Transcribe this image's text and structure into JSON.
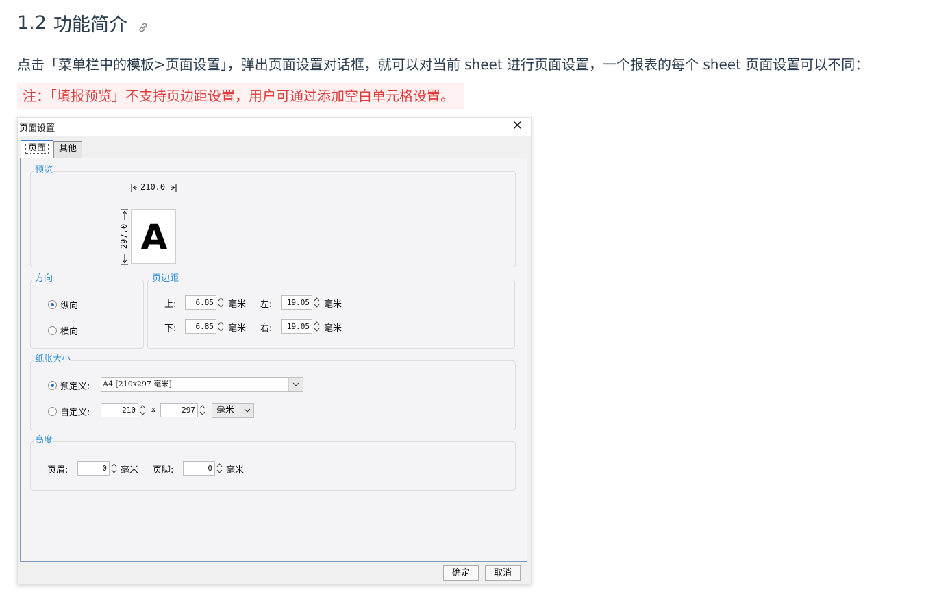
{
  "doc": {
    "heading_number": "1.2",
    "heading_text": "功能简介",
    "heading_icon": "link-icon",
    "paragraph": "点击「菜单栏中的模板>页面设置」，弹出页面设置对话框，就可以对当前 sheet 进行页面设置，一个报表的每个 sheet 页面设置可以不同：",
    "note": "注：「填报预览」不支持页边距设置，用户可通过添加空白单元格设置。"
  },
  "dialog": {
    "title": "页面设置",
    "close_icon": "close-icon",
    "tabs": [
      {
        "label": "页面",
        "active": true
      },
      {
        "label": "其他",
        "active": false
      }
    ],
    "preview": {
      "title": "预览",
      "width_label": "210.0",
      "height_label": "297.0",
      "letter": "A"
    },
    "orientation": {
      "title": "方向",
      "portrait_label": "纵向",
      "landscape_label": "横向",
      "selected": "portrait"
    },
    "margins": {
      "title": "页边距",
      "top_label": "上:",
      "top_value": "6.85",
      "left_label": "左:",
      "left_value": "19.05",
      "bottom_label": "下:",
      "bottom_value": "6.85",
      "right_label": "右:",
      "right_value": "19.05",
      "unit": "毫米"
    },
    "paper_size": {
      "title": "纸张大小",
      "predefined_label": "预定义:",
      "predefined_value": "A4 [210x297 毫米]",
      "custom_label": "自定义:",
      "custom_width": "210",
      "times": "x",
      "custom_height": "297",
      "custom_unit": "毫米",
      "selected": "predefined"
    },
    "height": {
      "title": "高度",
      "header_label": "页眉:",
      "header_value": "0",
      "footer_label": "页脚:",
      "footer_value": "0",
      "unit": "毫米"
    },
    "buttons": {
      "ok": "确定",
      "cancel": "取消"
    }
  }
}
